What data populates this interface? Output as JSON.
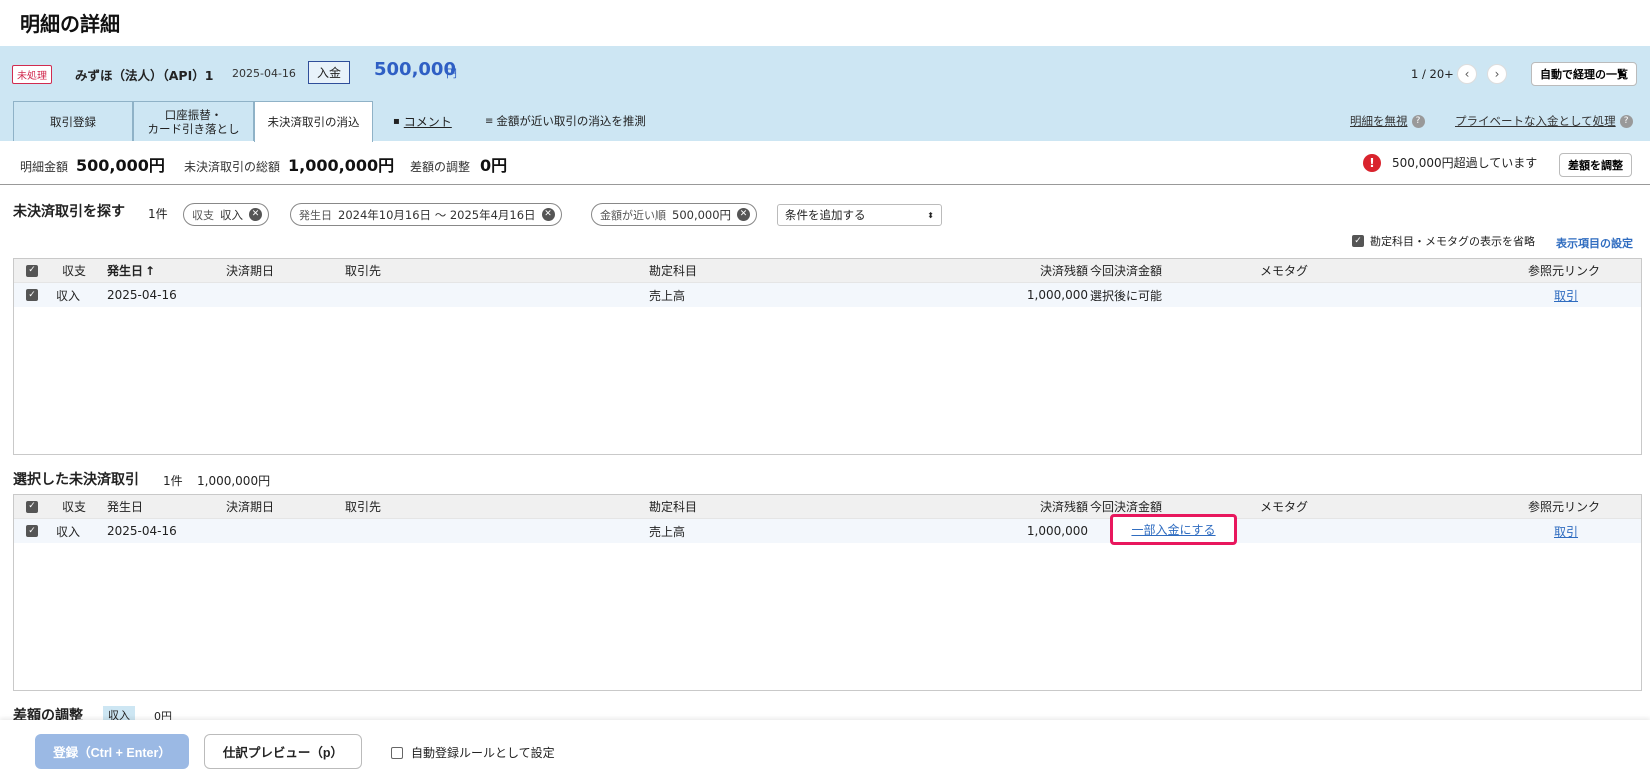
{
  "page_title": "明細の詳細",
  "header": {
    "status_badge": "未処理",
    "account": "みずほ（法人）（API）1",
    "date": "2025-04-16",
    "type_badge": "入金",
    "amount": "500,000",
    "amount_unit": "円",
    "pager": "1 / 20+",
    "prev": "‹",
    "next": "›",
    "auto_list_button": "自動で経理の一覧"
  },
  "tabs": [
    {
      "label": "取引登録"
    },
    {
      "label_line1": "口座振替・",
      "label_line2": "カード引き落とし"
    },
    {
      "label": "未決済取引の消込"
    }
  ],
  "tab_links": {
    "comment": "コメント",
    "estimate": "金額が近い取引の消込を推測",
    "ignore": "明細を無視",
    "private": "プライベートな入金として処理"
  },
  "summary": {
    "detail_amount_label": "明細金額",
    "detail_amount": "500,000円",
    "total_label": "未決済取引の総額",
    "total": "1,000,000円",
    "adjust_label": "差額の調整",
    "adjust": "0円",
    "warning": "500,000円超過しています",
    "adjust_button": "差額を調整"
  },
  "search": {
    "title": "未決済取引を探す",
    "count": "1件",
    "chips": [
      {
        "key": "収支",
        "value": "収入"
      },
      {
        "key": "発生日",
        "value": "2024年10月16日 〜 2025年4月16日"
      },
      {
        "key": "金額が近い順",
        "value": "500,000円"
      }
    ],
    "add_condition": "条件を追加する",
    "omit_label": "勘定科目・メモタグの表示を省略",
    "display_settings": "表示項目の設定"
  },
  "columns": {
    "type": "収支",
    "date": "発生日",
    "due": "決済期日",
    "partner": "取引先",
    "account": "勘定科目",
    "balance": "決済残額",
    "this_amount": "今回決済金額",
    "memo": "メモタグ",
    "ref": "参照元リンク"
  },
  "sort_arrow": "↑",
  "search_rows": [
    {
      "type": "収入",
      "date": "2025-04-16",
      "account": "売上高",
      "balance": "1,000,000",
      "this_amount": "選択後に可能",
      "ref": "取引"
    }
  ],
  "selected": {
    "title": "選択した未決済取引",
    "count": "1件",
    "amount": "1,000,000円",
    "rows": [
      {
        "type": "収入",
        "date": "2025-04-16",
        "account": "売上高",
        "balance": "1,000,000",
        "this_amount": "一部入金にする",
        "ref": "取引"
      }
    ]
  },
  "adjust_section": {
    "title": "差額の調整",
    "badge": "収入",
    "amount": "0円"
  },
  "footer": {
    "register": "登録（Ctrl + Enter）",
    "preview": "仕訳プレビュー（p）",
    "auto_rule": "自動登録ルールとして設定"
  },
  "colors": {
    "accent_blue": "#2f6cc0",
    "band": "#cde6f3",
    "highlight": "#e8175d",
    "warning_red": "#d9232d"
  }
}
